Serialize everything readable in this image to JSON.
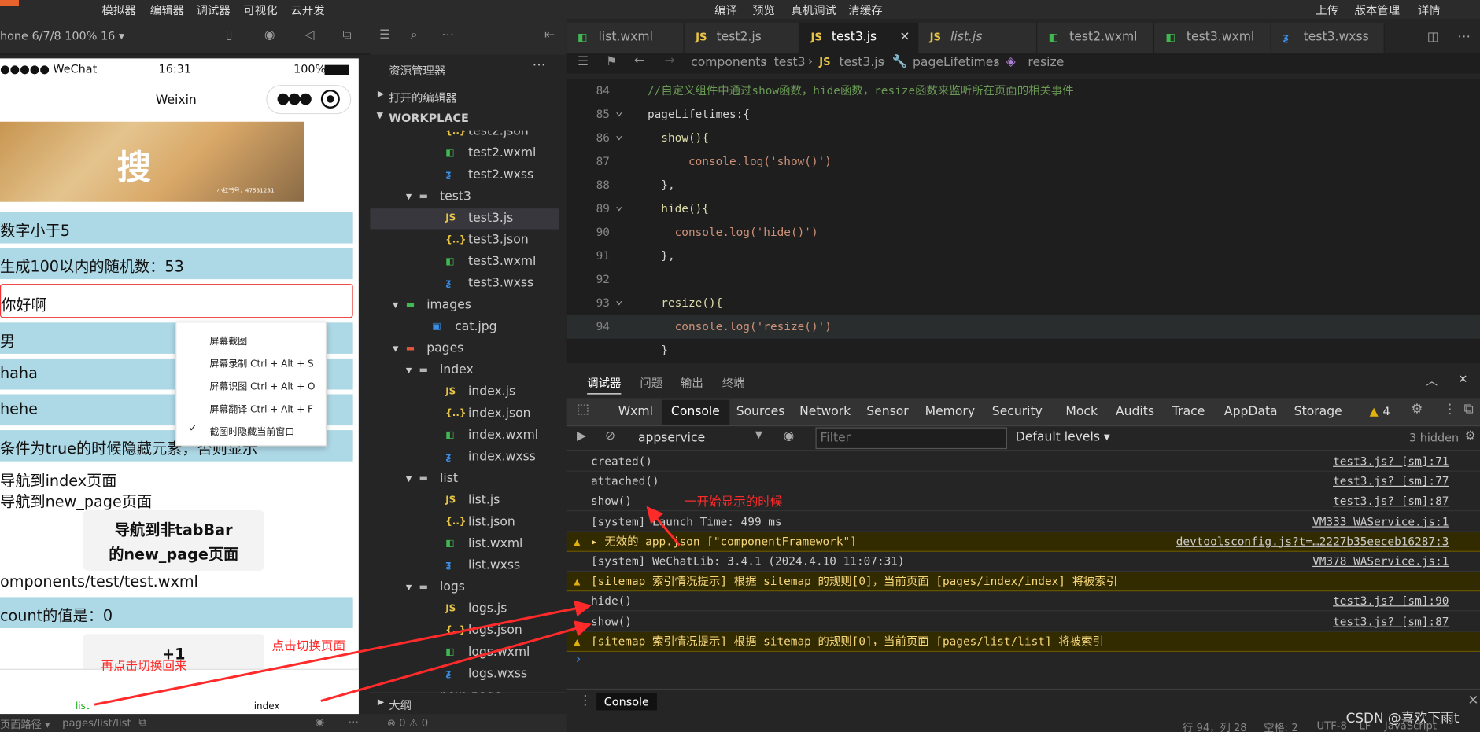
{
  "menubar": {
    "items": [
      "模拟器",
      "编辑器",
      "调试器",
      "可视化",
      "云开发"
    ],
    "center": [
      "编译",
      "预览",
      "真机调试",
      "清缓存"
    ],
    "right": [
      "上传",
      "版本管理",
      "详情"
    ]
  },
  "device_select": "hone 6/7/8 100% 16 ▾",
  "simulator": {
    "status_carrier": "●●●●● WeChat",
    "status_time": "16:31",
    "status_battery": "100%",
    "nav_title": "Weixin",
    "image_text": "搜",
    "image_caption": "小红书号：47531231",
    "bars": [
      "数字小于5",
      "生成100以内的随机数：53"
    ],
    "input_value": "你好啊",
    "bars2": [
      "男",
      "haha",
      "hehe"
    ],
    "bar_condition": "条件为true的时候隐藏元素，否则显示",
    "nav1": "导航到index页面",
    "nav2": "导航到new_page页面",
    "nav_button_l1": "导航到非tabBar",
    "nav_button_l2": "的new_page页面",
    "component_path": "omponents/test/test.wxml",
    "count_text": "count的值是：0",
    "plus_button": "+1",
    "tabbar_list": "list",
    "tabbar_index": "index"
  },
  "context_menu": {
    "items": [
      "屏幕截图",
      "屏幕录制 Ctrl + Alt + S",
      "屏幕识图 Ctrl + Alt + O",
      "屏幕翻译 Ctrl + Alt + F",
      "截图时隐藏当前窗口"
    ]
  },
  "explorer": {
    "title": "资源管理器",
    "open_editors": "打开的编辑器",
    "workspace": "WORKPLACE",
    "items": [
      {
        "name": "test2.json",
        "kind": "json",
        "depth": 2
      },
      {
        "name": "test2.wxml",
        "kind": "wxml",
        "depth": 2
      },
      {
        "name": "test2.wxss",
        "kind": "wxss",
        "depth": 2
      },
      {
        "name": "test3",
        "kind": "folder",
        "depth": 1
      },
      {
        "name": "test3.js",
        "kind": "js",
        "depth": 2
      },
      {
        "name": "test3.json",
        "kind": "json",
        "depth": 2
      },
      {
        "name": "test3.wxml",
        "kind": "wxml",
        "depth": 2
      },
      {
        "name": "test3.wxss",
        "kind": "wxss",
        "depth": 2
      },
      {
        "name": "images",
        "kind": "folder-img",
        "depth": 0
      },
      {
        "name": "cat.jpg",
        "kind": "jpg",
        "depth": 1
      },
      {
        "name": "pages",
        "kind": "folder-pages",
        "depth": 0
      },
      {
        "name": "index",
        "kind": "folder",
        "depth": 1
      },
      {
        "name": "index.js",
        "kind": "js",
        "depth": 2
      },
      {
        "name": "index.json",
        "kind": "json",
        "depth": 2
      },
      {
        "name": "index.wxml",
        "kind": "wxml",
        "depth": 2
      },
      {
        "name": "index.wxss",
        "kind": "wxss",
        "depth": 2
      },
      {
        "name": "list",
        "kind": "folder",
        "depth": 1
      },
      {
        "name": "list.js",
        "kind": "js",
        "depth": 2
      },
      {
        "name": "list.json",
        "kind": "json",
        "depth": 2
      },
      {
        "name": "list.wxml",
        "kind": "wxml",
        "depth": 2
      },
      {
        "name": "list.wxss",
        "kind": "wxss",
        "depth": 2
      },
      {
        "name": "logs",
        "kind": "folder",
        "depth": 1
      },
      {
        "name": "logs.js",
        "kind": "js",
        "depth": 2
      },
      {
        "name": "logs.json",
        "kind": "json",
        "depth": 2
      },
      {
        "name": "logs.wxml",
        "kind": "wxml",
        "depth": 2
      },
      {
        "name": "logs.wxss",
        "kind": "wxss",
        "depth": 2
      },
      {
        "name": "new_page",
        "kind": "folder",
        "depth": 1
      }
    ],
    "outline": "大纲"
  },
  "tabs": [
    {
      "label": "list.wxml",
      "kind": "wxml"
    },
    {
      "label": "test2.js",
      "kind": "js"
    },
    {
      "label": "test3.js",
      "kind": "js",
      "close": "✕"
    },
    {
      "label": "list.js",
      "kind": "js"
    },
    {
      "label": "test2.wxml",
      "kind": "wxml"
    },
    {
      "label": "test3.wxml",
      "kind": "wxml"
    },
    {
      "label": "test3.wxss",
      "kind": "wxss"
    }
  ],
  "breadcrumb": [
    "components",
    "test3",
    "test3.js",
    "pageLifetimes",
    "resize"
  ],
  "code_lines": [
    {
      "n": "84",
      "text": "//自定义组件中通过show函数，hide函数，resize函数来监听所在页面的相关事件"
    },
    {
      "n": "85",
      "text": "pageLifetimes:{"
    },
    {
      "n": "86",
      "text": "  show(){"
    },
    {
      "n": "87",
      "text": "      console.log('show()')"
    },
    {
      "n": "88",
      "text": "  },"
    },
    {
      "n": "89",
      "text": "  hide(){"
    },
    {
      "n": "90",
      "text": "    console.log('hide()')"
    },
    {
      "n": "91",
      "text": "  },"
    },
    {
      "n": "92",
      "text": ""
    },
    {
      "n": "93",
      "text": "  resize(){"
    },
    {
      "n": "94",
      "text": "    console.log('resize()')"
    },
    {
      "n": "",
      "text": "  }"
    }
  ],
  "panel_tabs": [
    "调试器",
    "问题",
    "输出",
    "终端"
  ],
  "devtools_tabs": [
    "Wxml",
    "Console",
    "Sources",
    "Network",
    "Sensor",
    "Memory",
    "Security",
    "Mock",
    "Audits",
    "Trace",
    "AppData",
    "Storage"
  ],
  "warn_count": "4",
  "console_toolbar": {
    "context": "appservice",
    "filter_placeholder": "Filter",
    "levels": "Default levels ▾",
    "hidden": "3 hidden"
  },
  "console_logs": [
    {
      "text": "created()",
      "link": "test3.js? [sm]:71",
      "warn": false
    },
    {
      "text": "attached()",
      "link": "test3.js? [sm]:77",
      "warn": false
    },
    {
      "text": "show()",
      "link": "test3.js? [sm]:87",
      "warn": false
    },
    {
      "text": "[system] Launch Time: 499 ms",
      "link": "VM333 WAService.js:1",
      "warn": false
    },
    {
      "text": "▸ 无效的 app.json [\"componentFramework\"]",
      "link": "devtoolsconfig.js?t=…2227b35eeceb16287:3",
      "warn": true
    },
    {
      "text": "[system] WeChatLib: 3.4.1 (2024.4.10 11:07:31)",
      "link": "VM378 WAService.js:1",
      "warn": false
    },
    {
      "text": "[sitemap 索引情况提示] 根据 sitemap 的规则[0]，当前页面 [pages/index/index] 将被索引",
      "link": "",
      "warn": true
    },
    {
      "text": "hide()",
      "link": "test3.js? [sm]:90",
      "warn": false
    },
    {
      "text": "show()",
      "link": "test3.js? [sm]:87",
      "warn": false
    },
    {
      "text": "[sitemap 索引情况提示] 根据 sitemap 的规则[0]，当前页面 [pages/list/list] 将被索引",
      "link": "",
      "warn": true
    }
  ],
  "console_prompt": "›",
  "console_drawer": "Console",
  "annotations": {
    "first_show": "一开始显示的时候",
    "click_switch": "点击切换页面",
    "click_back": "再点击切换回来"
  },
  "status_left": {
    "path_label": "页面路径 ▾",
    "path": "pages/list/list",
    "errors": "⊗ 0 ⚠ 0"
  },
  "status_right": {
    "position": "行 94，列 28",
    "spaces": "空格: 2",
    "encoding": "UTF-8",
    "eol": "LF",
    "lang": "JavaScript"
  },
  "watermark": "CSDN @喜欢下雨t",
  "colors": {
    "js": "#e8c547",
    "json": "#e8c547",
    "wxml": "#3fb950",
    "wxss": "#3a8ee6",
    "folder": "#b4b4b4",
    "accent": "#1aad19"
  }
}
